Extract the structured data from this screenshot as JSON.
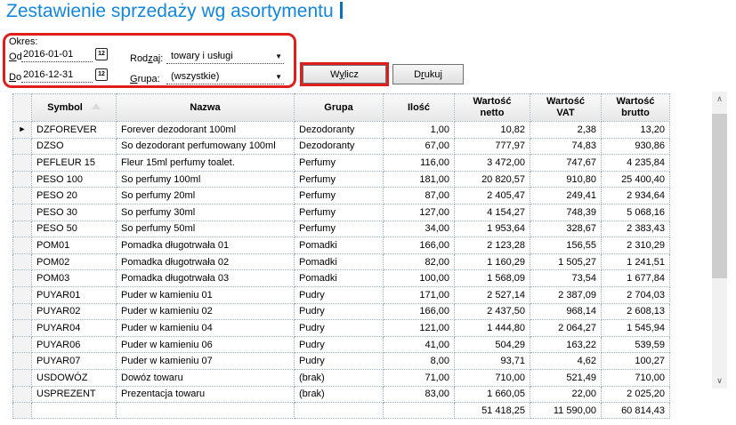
{
  "page": {
    "title": "Zestawienie sprzedaży wg asortymentu"
  },
  "filters": {
    "okres_label": "Okres:",
    "od": {
      "pre": "",
      "key": "O",
      "post": "d:"
    },
    "od_value": "2016-01-01",
    "do": {
      "pre": "",
      "key": "D",
      "post": "o:"
    },
    "do_value": "2016-12-31",
    "rodzaj": {
      "pre": "Rod",
      "key": "z",
      "post": "aj:"
    },
    "rodzaj_value": "towary i usługi",
    "grupa": {
      "pre": "",
      "key": "G",
      "post": "rupa:"
    },
    "grupa_value": "(wszystkie)"
  },
  "toolbar": {
    "wylicz": {
      "pre": "W",
      "key": "y",
      "post": "licz"
    },
    "drukuj": {
      "pre": "D",
      "key": "r",
      "post": "ukuj"
    }
  },
  "icons": {
    "calendar": "12",
    "dropdown": "▼",
    "row_pointer": "►",
    "scroll_up": "∧",
    "scroll_down": "∨"
  },
  "colors": {
    "accent_blue": "#1287e0",
    "annotation_red": "#e01e1e"
  },
  "table": {
    "columns": [
      "Symbol",
      "Nazwa",
      "Grupa",
      "Ilość",
      "Wartość\nnetto",
      "Wartość\nVAT",
      "Wartość\nbrutto"
    ],
    "current_row_index": 0,
    "rows": [
      {
        "symbol": "DZFOREVER",
        "nazwa": "Forever dezodorant 100ml",
        "grupa": "Dezodoranty",
        "ilosc": "1,00",
        "netto": "10,82",
        "vat": "2,38",
        "brutto": "13,20"
      },
      {
        "symbol": "DZSO",
        "nazwa": "So dezodorant perfumowany 100ml",
        "grupa": "Dezodoranty",
        "ilosc": "67,00",
        "netto": "777,97",
        "vat": "74,83",
        "brutto": "930,86"
      },
      {
        "symbol": "PEFLEUR 15",
        "nazwa": "Fleur 15ml perfumy toalet.",
        "grupa": "Perfumy",
        "ilosc": "116,00",
        "netto": "3 472,00",
        "vat": "747,67",
        "brutto": "4 235,84"
      },
      {
        "symbol": "PESO 100",
        "nazwa": "So perfumy 100ml",
        "grupa": "Perfumy",
        "ilosc": "181,00",
        "netto": "20 820,57",
        "vat": "910,80",
        "brutto": "25 400,40"
      },
      {
        "symbol": "PESO 20",
        "nazwa": "So perfumy 20ml",
        "grupa": "Perfumy",
        "ilosc": "87,00",
        "netto": "2 405,47",
        "vat": "249,41",
        "brutto": "2 934,64"
      },
      {
        "symbol": "PESO 30",
        "nazwa": "So perfumy 30ml",
        "grupa": "Perfumy",
        "ilosc": "127,00",
        "netto": "4 154,27",
        "vat": "748,39",
        "brutto": "5 068,16"
      },
      {
        "symbol": "PESO 50",
        "nazwa": "So perfumy 50ml",
        "grupa": "Perfumy",
        "ilosc": "34,00",
        "netto": "1 953,64",
        "vat": "328,67",
        "brutto": "2 383,43"
      },
      {
        "symbol": "POM01",
        "nazwa": "Pomadka długotrwała 01",
        "grupa": "Pomadki",
        "ilosc": "166,00",
        "netto": "2 123,28",
        "vat": "156,55",
        "brutto": "2 310,29"
      },
      {
        "symbol": "POM02",
        "nazwa": "Pomadka długotrwała 02",
        "grupa": "Pomadki",
        "ilosc": "82,00",
        "netto": "1 160,29",
        "vat": "1 505,27",
        "brutto": "1 241,51"
      },
      {
        "symbol": "POM03",
        "nazwa": "Pomadka długotrwała 03",
        "grupa": "Pomadki",
        "ilosc": "100,00",
        "netto": "1 568,09",
        "vat": "73,54",
        "brutto": "1 677,84"
      },
      {
        "symbol": "PUYAR01",
        "nazwa": "Puder w kamieniu 01",
        "grupa": "Pudry",
        "ilosc": "171,00",
        "netto": "2 527,14",
        "vat": "2 387,09",
        "brutto": "2 704,03"
      },
      {
        "symbol": "PUYAR02",
        "nazwa": "Puder w kamieniu 02",
        "grupa": "Pudry",
        "ilosc": "166,00",
        "netto": "2 437,50",
        "vat": "968,14",
        "brutto": "2 608,13"
      },
      {
        "symbol": "PUYAR04",
        "nazwa": "Puder w kamieniu 04",
        "grupa": "Pudry",
        "ilosc": "121,00",
        "netto": "1 444,80",
        "vat": "2 064,27",
        "brutto": "1 545,94"
      },
      {
        "symbol": "PUYAR06",
        "nazwa": "Puder w kamieniu 06",
        "grupa": "Pudry",
        "ilosc": "41,00",
        "netto": "504,29",
        "vat": "163,22",
        "brutto": "539,59"
      },
      {
        "symbol": "PUYAR07",
        "nazwa": "Puder w kamieniu 07",
        "grupa": "Pudry",
        "ilosc": "8,00",
        "netto": "93,71",
        "vat": "4,62",
        "brutto": "100,27"
      },
      {
        "symbol": "USDOWÓZ",
        "nazwa": "Dowóz towaru",
        "grupa": "(brak)",
        "ilosc": "71,00",
        "netto": "710,00",
        "vat": "521,49",
        "brutto": "710,00"
      },
      {
        "symbol": "USPREZENT",
        "nazwa": "Prezentacja towaru",
        "grupa": "(brak)",
        "ilosc": "83,00",
        "netto": "1 660,05",
        "vat": "22,00",
        "brutto": "2 025,20"
      }
    ],
    "totals": {
      "netto": "51 418,25",
      "vat": "11 590,00",
      "brutto": "60 814,43"
    }
  }
}
